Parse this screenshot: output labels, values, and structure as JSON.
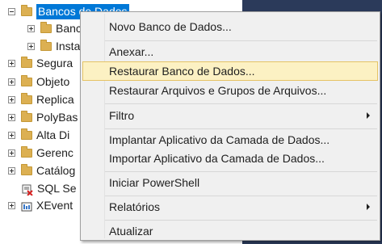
{
  "tree": {
    "items": [
      {
        "label": "Bancos de Dados",
        "expander": "minus",
        "icon": "folder-icon",
        "selected": true
      },
      {
        "label": "Banco",
        "expander": "plus",
        "icon": "folder-icon"
      },
      {
        "label": "Insta",
        "expander": "plus",
        "icon": "folder-icon"
      },
      {
        "label": "Segura",
        "expander": "plus",
        "icon": "folder-icon"
      },
      {
        "label": "Objeto",
        "expander": "plus",
        "icon": "folder-icon"
      },
      {
        "label": "Replica",
        "expander": "plus",
        "icon": "folder-icon"
      },
      {
        "label": "PolyBas",
        "expander": "plus",
        "icon": "folder-icon"
      },
      {
        "label": "Alta Di",
        "expander": "plus",
        "icon": "folder-icon"
      },
      {
        "label": "Gerenc",
        "expander": "plus",
        "icon": "folder-icon"
      },
      {
        "label": "Catálog",
        "expander": "plus",
        "icon": "folder-icon"
      },
      {
        "label": "SQL Se",
        "expander": "none",
        "icon": "sql-agent-icon"
      },
      {
        "label": "XEvent",
        "expander": "plus",
        "icon": "xevent-icon"
      }
    ]
  },
  "context_menu": {
    "items": [
      {
        "label": "Novo Banco de Dados...",
        "submenu": false
      },
      {
        "separator": true
      },
      {
        "label": "Anexar...",
        "submenu": false
      },
      {
        "label": "Restaurar Banco de Dados...",
        "submenu": false,
        "highlighted": true
      },
      {
        "label": "Restaurar Arquivos e Grupos de Arquivos...",
        "submenu": false
      },
      {
        "separator": true
      },
      {
        "label": "Filtro",
        "submenu": true
      },
      {
        "separator": true
      },
      {
        "label": "Implantar Aplicativo da Camada de Dados...",
        "submenu": false
      },
      {
        "label": "Importar Aplicativo da Camada de Dados...",
        "submenu": false
      },
      {
        "separator": true
      },
      {
        "label": "Iniciar PowerShell",
        "submenu": false
      },
      {
        "separator": true
      },
      {
        "label": "Relatórios",
        "submenu": true
      },
      {
        "separator": true
      },
      {
        "label": "Atualizar",
        "submenu": false
      }
    ]
  },
  "colors": {
    "selection": "#0078d7",
    "menu_highlight": "#fcf1c3",
    "menu_highlight_border": "#e5c365",
    "right_panel": "#2b3a5a",
    "menu_background": "#f0f0f0"
  }
}
